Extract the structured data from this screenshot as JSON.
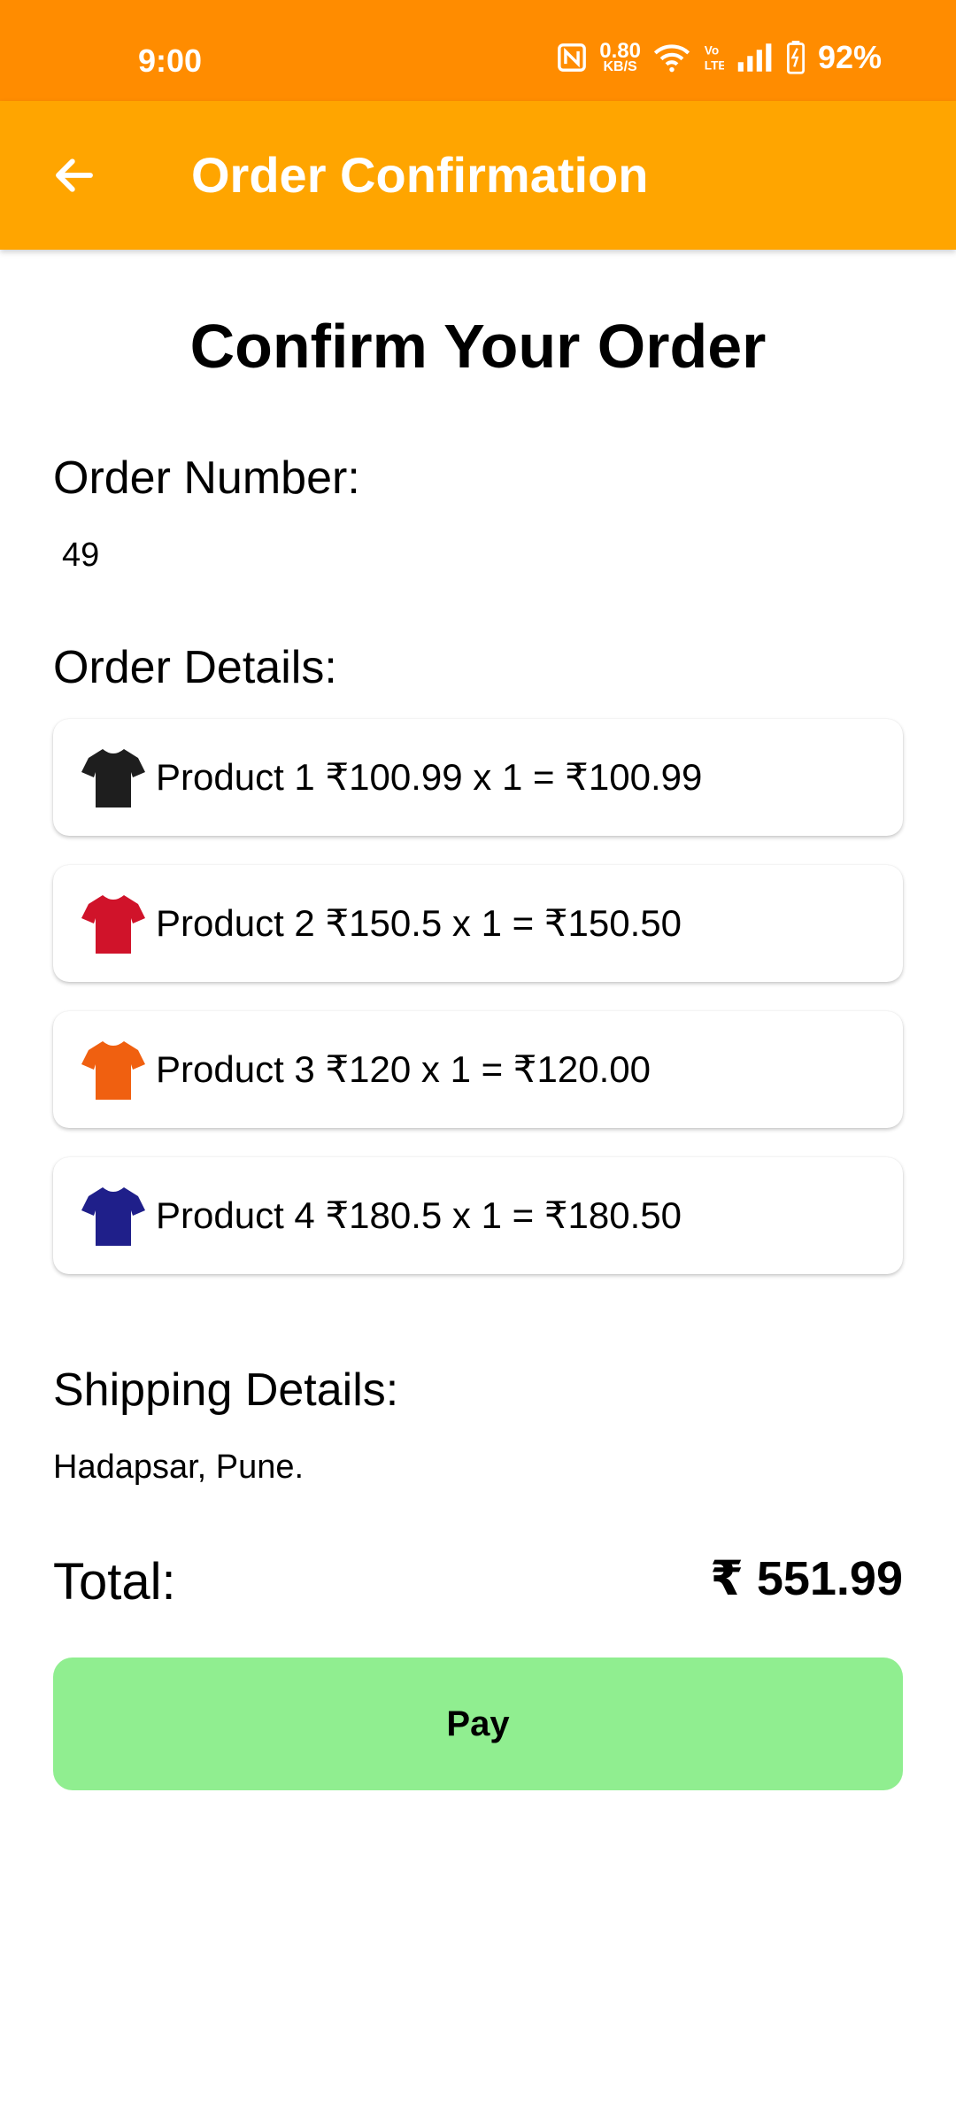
{
  "status_bar": {
    "time": "9:00",
    "net_speed_value": "0.80",
    "net_speed_unit": "KB/S",
    "battery": "92%",
    "icons": [
      "nfc-icon",
      "wifi-icon",
      "volte-icon",
      "signal-icon",
      "battery-icon"
    ]
  },
  "app_bar": {
    "title": "Order Confirmation",
    "back_icon": "arrow-left-icon",
    "color": "#ffa500"
  },
  "heading": "Confirm Your Order",
  "order_number": {
    "label": "Order Number:",
    "value": "49"
  },
  "order_details": {
    "label": "Order Details:",
    "items": [
      {
        "text": "Product 1 ₹100.99 x 1 = ₹100.99",
        "shirt_color": "#1e1e1e",
        "icon": "tshirt-icon"
      },
      {
        "text": "Product 2 ₹150.5 x 1 = ₹150.50",
        "shirt_color": "#d0132a",
        "icon": "tshirt-icon"
      },
      {
        "text": "Product 3 ₹120 x 1 = ₹120.00",
        "shirt_color": "#f06010",
        "icon": "tshirt-icon"
      },
      {
        "text": "Product 4 ₹180.5 x 1 = ₹180.50",
        "shirt_color": "#1f1f8a",
        "icon": "tshirt-icon"
      }
    ]
  },
  "shipping": {
    "label": "Shipping Details:",
    "address": "Hadapsar, Pune."
  },
  "total": {
    "label": "Total:",
    "value": "₹ 551.99"
  },
  "pay_button": {
    "label": "Pay",
    "color": "#90ee90"
  }
}
